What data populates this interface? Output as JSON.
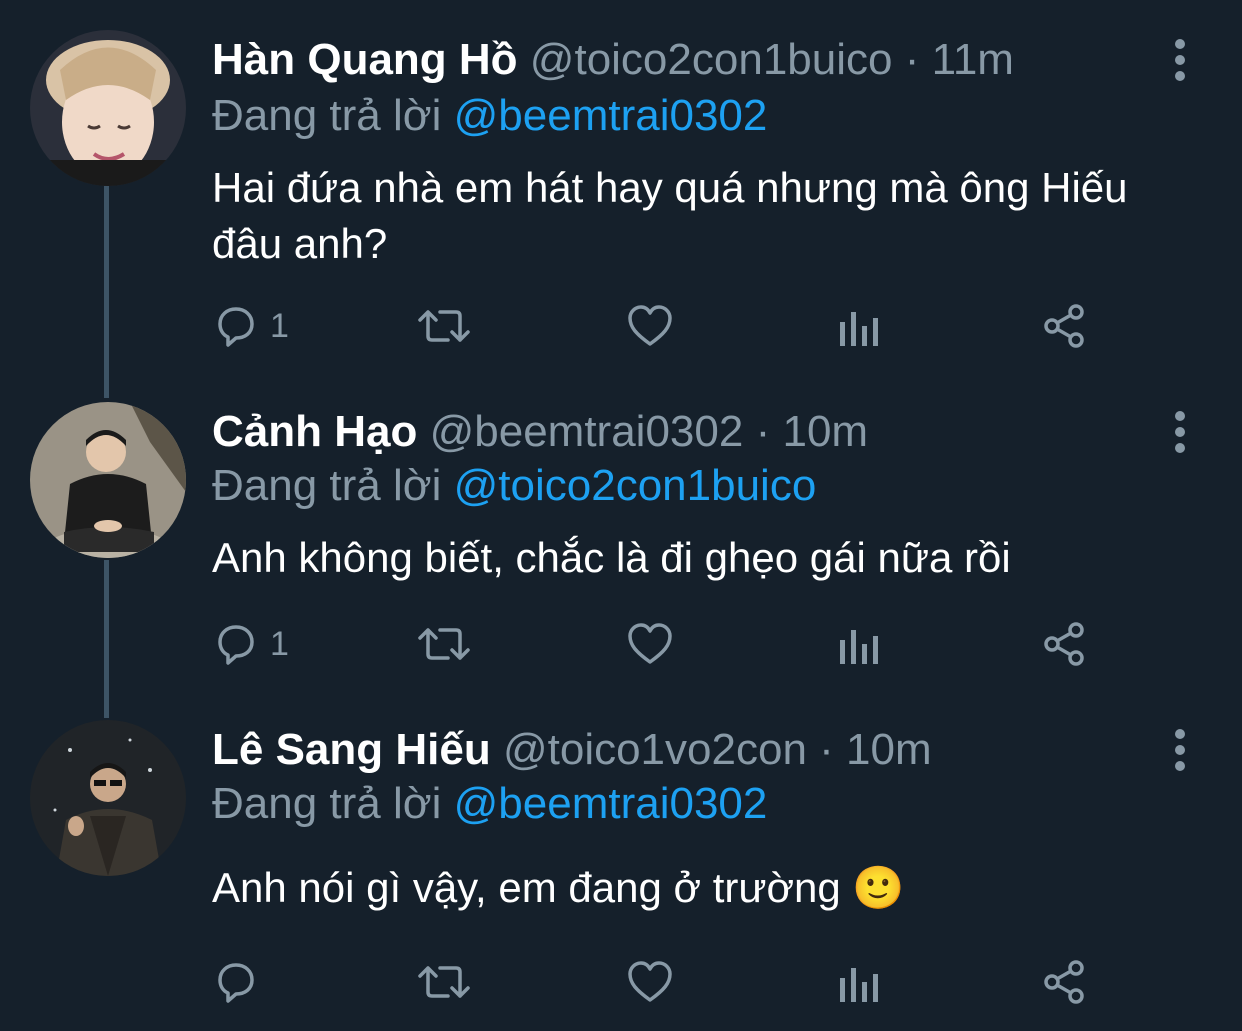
{
  "reply_prefix": "Đang trả lời",
  "colors": {
    "background": "#15202b",
    "muted": "#8899a6",
    "accent": "#1da1f2",
    "thread_line": "#3d5466"
  },
  "tweets": [
    {
      "name": "Hàn Quang Hồ",
      "handle": "@toico2con1buico",
      "dot": "·",
      "time": "11m",
      "reply_to": "@beemtrai0302",
      "text": "Hai đứa nhà em hát hay quá nhưng mà ông Hiếu đâu anh?",
      "reply_count": "1",
      "icons": [
        "reply-icon",
        "retweet-icon",
        "like-icon",
        "analytics-icon",
        "share-icon"
      ]
    },
    {
      "name": "Cảnh Hạo",
      "handle": "@beemtrai0302",
      "dot": "·",
      "time": "10m",
      "reply_to": "@toico2con1buico",
      "text": "Anh không biết, chắc là đi ghẹo gái nữa rồi",
      "reply_count": "1",
      "icons": [
        "reply-icon",
        "retweet-icon",
        "like-icon",
        "analytics-icon",
        "share-icon"
      ]
    },
    {
      "name": "Lê Sang Hiếu",
      "handle": "@toico1vo2con",
      "dot": "·",
      "time": "10m",
      "reply_to": "@beemtrai0302",
      "text": "Anh nói gì vậy, em đang ở trường 🙂",
      "reply_count": "",
      "icons": [
        "reply-icon",
        "retweet-icon",
        "like-icon",
        "analytics-icon",
        "share-icon"
      ]
    }
  ]
}
